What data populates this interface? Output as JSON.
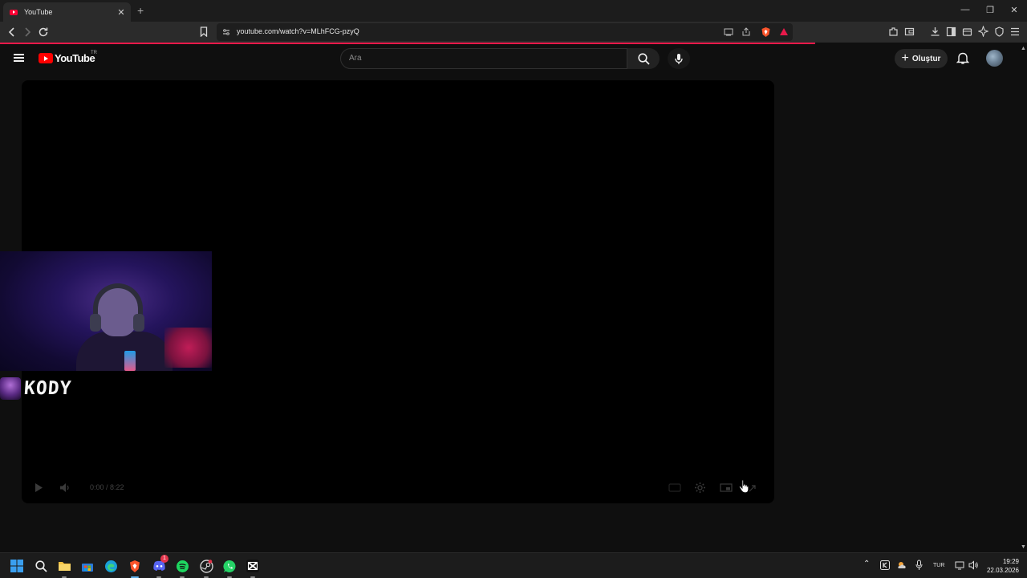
{
  "browser": {
    "tab_title": "YouTube",
    "tab_close": "✕",
    "new_tab": "+",
    "url": "youtube.com/watch?v=MLhFCG-pzyQ",
    "window_controls": [
      "—",
      "❐",
      "✕"
    ]
  },
  "youtube": {
    "logo_text": "YouTube",
    "country_code": "TR",
    "search_placeholder": "Ara",
    "create_label": "Oluştur",
    "create_plus": "+"
  },
  "player": {
    "time": "0:00 / 8:22"
  },
  "overlay": {
    "streamer_name": "KODY"
  },
  "taskbar": {
    "apps": [
      "windows-start",
      "search",
      "file-explorer",
      "microsoft-store",
      "edge",
      "brave",
      "discord",
      "spotify",
      "steam",
      "whatsapp",
      "capcut"
    ],
    "discord_badge": "1",
    "language": "TUR",
    "time": "19:29",
    "date": "22.03.2026"
  },
  "colors": {
    "accent": "#ff0033",
    "loadline": "#e8194a",
    "background": "#0f0f0f"
  }
}
